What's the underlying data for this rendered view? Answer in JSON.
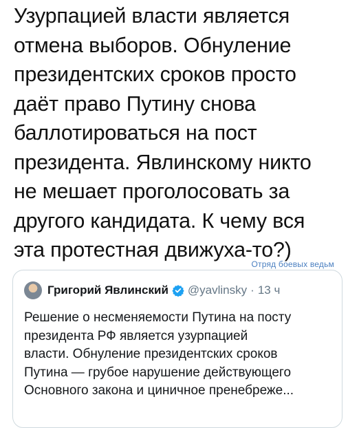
{
  "tweet": {
    "lines": [
      "Узурпацией власти является",
      "отмена выборов. Обнуление",
      "президентских сроков просто",
      "даёт право Путину снова",
      "баллотироваться на пост",
      "президента. Явлинскому никто",
      "не мешает проголосовать за",
      "другого кандидата. К чему вся",
      "эта протестная движуха-то?)"
    ]
  },
  "watermark": "Отряд боевых ведьм",
  "quoted_tweet": {
    "author_name": "Григорий Явлинский",
    "handle": "@yavlinsky",
    "separator": "·",
    "time": "13 ч",
    "lines": [
      "Решение о несменяемости Путина на посту",
      "президента РФ является узурпацией",
      "власти. Обнуление президентских сроков",
      "Путина — грубое нарушение действующего",
      "Основного закона и циничное пренебреже..."
    ]
  },
  "colors": {
    "verified_badge": "#1da1f2",
    "border": "#cfd9de",
    "secondary_text": "#657786",
    "watermark": "#4a7fc0"
  }
}
